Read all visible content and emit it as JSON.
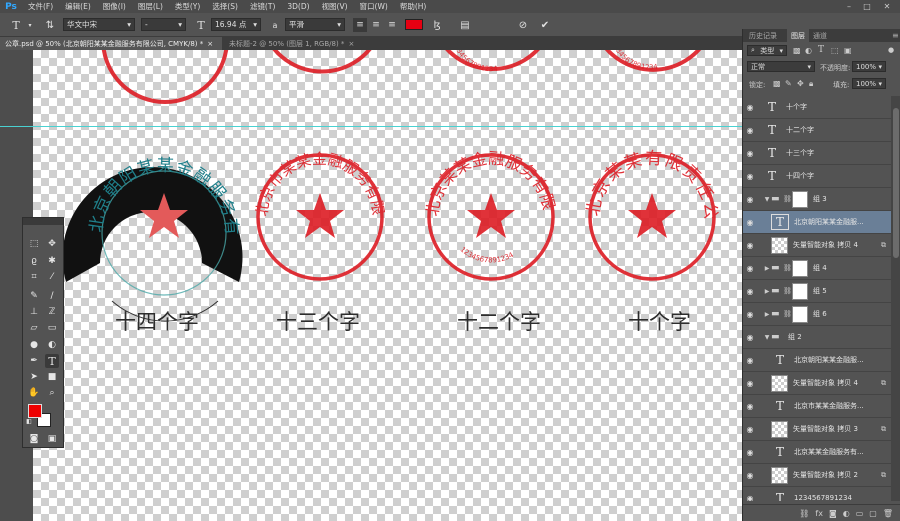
{
  "app": {
    "logo": "Ps"
  },
  "menu": [
    "文件(F)",
    "编辑(E)",
    "图像(I)",
    "图层(L)",
    "类型(Y)",
    "选择(S)",
    "滤镜(T)",
    "3D(D)",
    "视图(V)",
    "窗口(W)",
    "帮助(H)"
  ],
  "options": {
    "font_family": "华文中宋",
    "font_style": "-",
    "font_size": "16.94 点",
    "aa_label": "a",
    "antialias": "平滑",
    "text_color": "#e60012"
  },
  "tabs": [
    {
      "label": "公章.psd @ 50% (北京朝阳某某金融服务有限公司, CMYK/8) *",
      "close": "×"
    },
    {
      "label": "未标题-2 @ 50% (图层 1, RGB/8) *",
      "close": "×"
    }
  ],
  "canvas": {
    "captions": [
      "十四个字",
      "十三个字",
      "十二个字",
      "十个字"
    ],
    "stamp_texts": [
      "北京朝阳某某金融服务有限公司",
      "北京市某某金融服务有限公司",
      "北京某某金融服务有限公司",
      "北京某某有限责任公司"
    ],
    "stamp_numbers": [
      "1234567891234",
      "1234567891234",
      "1234567891234"
    ],
    "stamp_color": "#dd1c24"
  },
  "panel": {
    "tabs": [
      "历史记录",
      "图层",
      "通道"
    ],
    "filter_kind": "类型",
    "blend_mode": "正常",
    "opacity_label": "不透明度:",
    "opacity": "100%",
    "lock_label": "锁定:",
    "fill_label": "填充:",
    "fill": "100%"
  },
  "layers": [
    {
      "name": "十个字",
      "kind": "text"
    },
    {
      "name": "十二个字",
      "kind": "text"
    },
    {
      "name": "十三个字",
      "kind": "text"
    },
    {
      "name": "十四个字",
      "kind": "text"
    },
    {
      "name": "组 3",
      "kind": "group",
      "expanded": true
    },
    {
      "name": "北京朝阳某某金融服...",
      "kind": "text",
      "selected": true
    },
    {
      "name": "矢量智能对象 拷贝 4",
      "kind": "smart"
    },
    {
      "name": "组 4",
      "kind": "group"
    },
    {
      "name": "组 5",
      "kind": "group"
    },
    {
      "name": "组 6",
      "kind": "group"
    },
    {
      "name": "组 2",
      "kind": "group",
      "expanded": true
    },
    {
      "name": "北京朝阳某某金融服...",
      "kind": "text"
    },
    {
      "name": "矢量智能对象 拷贝 4",
      "kind": "smart"
    },
    {
      "name": "北京市某某金融服务...",
      "kind": "text"
    },
    {
      "name": "矢量智能对象 拷贝 3",
      "kind": "smart"
    },
    {
      "name": "北京某某金融服务有...",
      "kind": "text"
    },
    {
      "name": "矢量智能对象 拷贝 2",
      "kind": "smart"
    },
    {
      "name": "1234567891234",
      "kind": "text"
    }
  ],
  "icons": {
    "eye": "eye-icon",
    "lock": "lock-icon",
    "link": "link-icon",
    "folder": "folder-icon"
  }
}
